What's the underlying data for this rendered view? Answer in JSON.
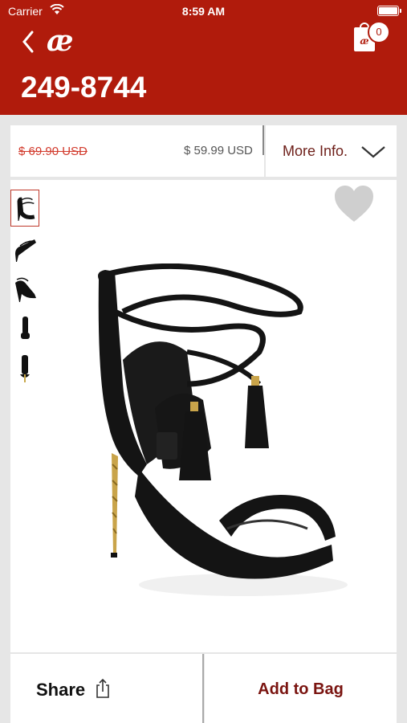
{
  "status_bar": {
    "carrier": "Carrier",
    "time": "8:59 AM"
  },
  "header": {
    "logo": "æ",
    "title": "249-8744",
    "bag_count": "0",
    "bag_icon_text": "æ",
    "color": "#b01b0c"
  },
  "price": {
    "original": "$ 69.90  USD",
    "current": "$ 59.99  USD",
    "more_info_label": "More Info."
  },
  "gallery": {
    "thumbnails": [
      "sandal-front-view",
      "sandal-side-view",
      "sandal-back-view",
      "sandal-heel-view",
      "sandal-rear-view"
    ],
    "selected_index": 0
  },
  "actions": {
    "share_label": "Share",
    "add_to_bag_label": "Add to Bag"
  }
}
